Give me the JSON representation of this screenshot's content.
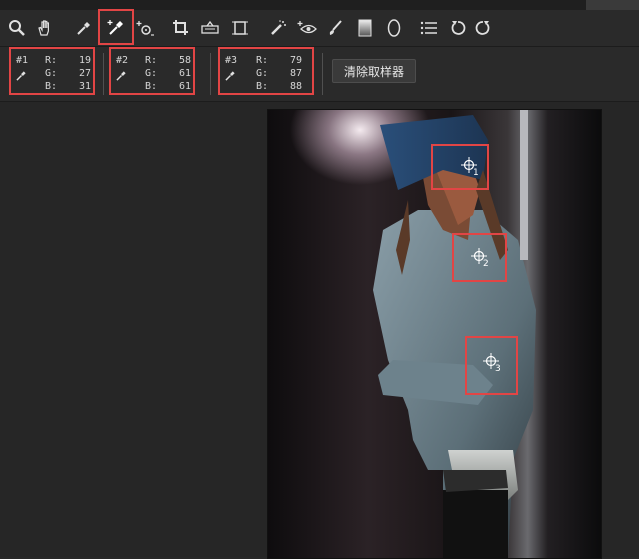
{
  "toolbar": {
    "tools": [
      {
        "name": "zoom-tool",
        "icon": "magnifier-icon"
      },
      {
        "name": "hand-tool",
        "icon": "hand-icon"
      },
      {
        "name": "white-balance-tool",
        "icon": "eyedropper-icon"
      },
      {
        "name": "color-sampler-tool",
        "icon": "color-sampler-icon",
        "active": true
      },
      {
        "name": "targeted-adjustment-tool",
        "icon": "target-adjust-icon"
      },
      {
        "name": "crop-tool",
        "icon": "crop-icon"
      },
      {
        "name": "straighten-tool",
        "icon": "level-icon"
      },
      {
        "name": "transform-tool",
        "icon": "transform-icon"
      },
      {
        "name": "spot-removal-tool",
        "icon": "spot-brush-icon"
      },
      {
        "name": "red-eye-tool",
        "icon": "red-eye-icon"
      },
      {
        "name": "adjustment-brush-tool",
        "icon": "brush-icon"
      },
      {
        "name": "graduated-filter-tool",
        "icon": "gradient-icon"
      },
      {
        "name": "radial-filter-tool",
        "icon": "ellipse-icon"
      },
      {
        "name": "preferences",
        "icon": "list-icon"
      },
      {
        "name": "rotate-left",
        "icon": "rotate-ccw-icon"
      },
      {
        "name": "rotate-right",
        "icon": "rotate-cw-icon"
      }
    ]
  },
  "samplers": [
    {
      "id": "#1",
      "r_label": "R:",
      "r": "19",
      "g_label": "G:",
      "g": "27",
      "b_label": "B:",
      "b": "31"
    },
    {
      "id": "#2",
      "r_label": "R:",
      "r": "58",
      "g_label": "G:",
      "g": "61",
      "b_label": "B:",
      "b": "61"
    },
    {
      "id": "#3",
      "r_label": "R:",
      "r": "79",
      "g_label": "G:",
      "g": "87",
      "b_label": "B:",
      "b": "88"
    }
  ],
  "clear_samplers_label": "清除取样器",
  "markers": [
    {
      "label": "1"
    },
    {
      "label": "2"
    },
    {
      "label": "3"
    }
  ],
  "colors": {
    "highlight": "#e24545",
    "panel": "#2a2a2a",
    "canvas": "#262626"
  }
}
